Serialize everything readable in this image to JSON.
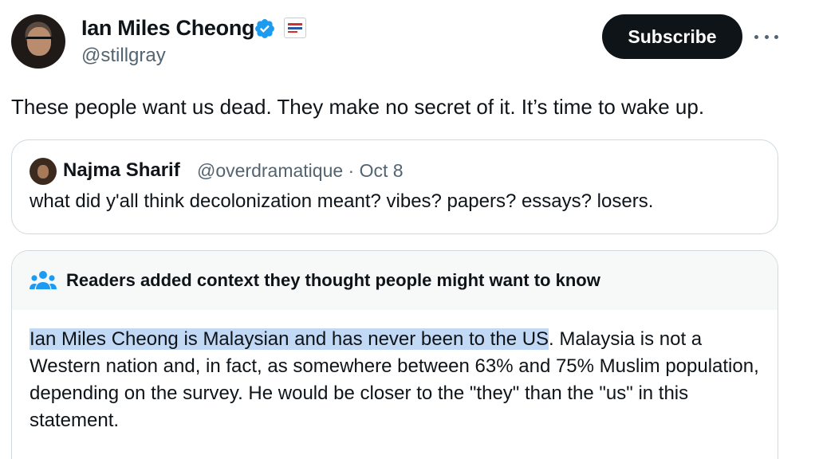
{
  "author": {
    "name": "Ian Miles Cheong",
    "handle": "@stillgray"
  },
  "actions": {
    "subscribe_label": "Subscribe"
  },
  "tweet": {
    "text": "These people want us dead. They make no secret of it. It’s time to wake up."
  },
  "quoted_tweet": {
    "name": "Najma Sharif",
    "meta": "@overdramatique · Oct 8",
    "text": "what did y'all think decolonization meant? vibes? papers? essays? losers."
  },
  "community_note": {
    "title": "Readers added context they thought people might want to know",
    "highlighted": "Ian Miles Cheong is Malaysian and has never been to the US",
    "rest": ". Malaysia is not a Western nation and, in fact, as somewhere between 63% and 75% Muslim population, depending on the survey. He would be closer to the \"they\" than the \"us\" in this statement."
  },
  "colors": {
    "text": "#0f1419",
    "secondary": "#536471",
    "verified": "#1d9bf0",
    "border": "#cfd9de",
    "highlight": "#c2d9f5"
  },
  "icons": [
    "verified-badge-icon",
    "affiliate-badge-icon",
    "more-icon",
    "readers-icon"
  ]
}
